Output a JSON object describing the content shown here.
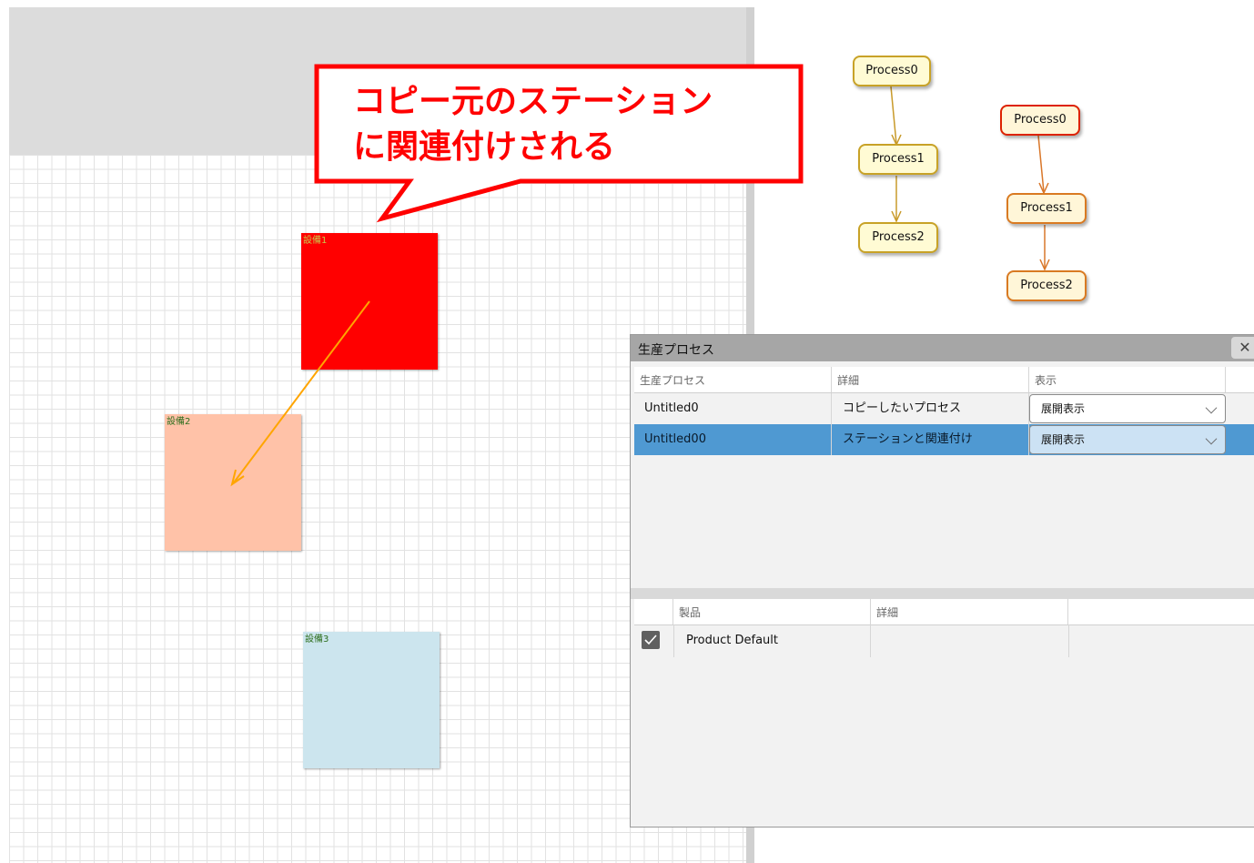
{
  "canvas": {
    "stations": [
      {
        "label": "設備1",
        "color": "#ff0000"
      },
      {
        "label": "設備2",
        "color": "#ffc2a8"
      },
      {
        "label": "設備3",
        "color": "#cce5ee"
      }
    ],
    "link_arrow_color": "#ffa500"
  },
  "callout": {
    "line1": "コピー元のステーション",
    "line2": "に関連付けされる",
    "color": "#ff0000"
  },
  "process_graph": {
    "left": [
      "Process0",
      "Process1",
      "Process2"
    ],
    "right": [
      "Process0",
      "Process1",
      "Process2"
    ]
  },
  "dialog": {
    "title": "生産プロセス",
    "close_glyph": "✕",
    "process_table": {
      "headers": [
        "生産プロセス",
        "詳細",
        "表示"
      ],
      "rows": [
        {
          "name": "Untitled0",
          "detail": "コピーしたいプロセス",
          "display": "展開表示",
          "selected": false
        },
        {
          "name": "Untitled00",
          "detail": "ステーションと関連付け",
          "display": "展開表示",
          "selected": true
        }
      ]
    },
    "product_table": {
      "headers": [
        "",
        "製品",
        "詳細"
      ],
      "rows": [
        {
          "checked": true,
          "name": "Product Default",
          "detail": ""
        }
      ]
    }
  }
}
